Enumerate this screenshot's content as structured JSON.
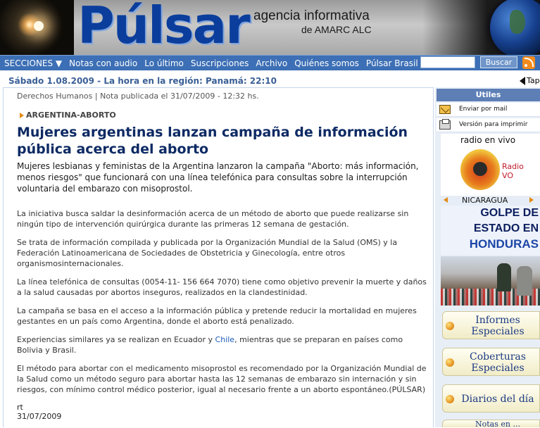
{
  "header": {
    "brand": "Púlsar",
    "tagline_line1": "agencia informativa",
    "tagline_line2": "de AMARC ALC"
  },
  "nav": {
    "items": [
      "SECCIONES ▼",
      "Notas con audio",
      "Lo último",
      "Suscripciones",
      "Archivo",
      "Quiénes somos",
      "Púlsar Brasil"
    ],
    "search_button": "Buscar",
    "search_placeholder": ""
  },
  "datebar": {
    "text": "Sábado 1.08.2009 -  La hora en la región:  Panamá: 22:10",
    "tap_label": "Tap"
  },
  "article": {
    "meta": "Derechos Humanos | Nota publicada el 31/07/2009 - 12:32 hs.",
    "kicker": "ARGENTINA-ABORTO",
    "headline": "Mujeres argentinas lanzan campaña de información pública acerca del aborto",
    "lead": "Mujeres lesbianas y feministas de la Argentina lanzaron la campaña \"Aborto: más información, menos riesgos\" que funcionará con una línea telefónica para consultas sobre la interrupción voluntaria del embarazo con misoprostol.",
    "paragraphs": [
      "La iniciativa busca saldar la desinformación acerca de un método de aborto que puede realizarse sin ningún tipo de intervención quirúrgica durante las primeras 12 semana de gestación.",
      "Se trata de información compilada y publicada por la Organización Mundial de la Salud (OMS) y la Federación Latinoamericana de Sociedades de Obstetricia y Ginecología, entre otros organismosinternacionales.",
      "La línea telefónica de consultas (0054-11- 156 664 7070) tiene como objetivo prevenir la muerte y daños a la salud causadas por abortos inseguros, realizados en la clandestinidad.",
      "La campaña se basa en el acceso a la información pública y pretende reducir la mortalidad en mujeres gestantes en un país como Argentina, donde el aborto está penalizado."
    ],
    "para5_before": "Experiencias similares ya se realizan en Ecuador y ",
    "para5_link": "Chile",
    "para5_after": ", mientras que se preparan en países como Bolivia y Brasil.",
    "para6": "El método para abortar con el medicamento misoprostol es recomendado por la Organización Mundial de la Salud como un método seguro para abortar hasta las 12 semanas de embarazo sin internación y sin riesgos, con mínimo control médico posterior, igual al necesario frente a un aborto espontáneo.(PÚLSAR)",
    "author": "rt",
    "date": "31/07/2009"
  },
  "sidebar": {
    "utiles_title": "Utiles",
    "email_label": "Enviar por mail",
    "print_label": "Versión para imprimir",
    "radio_title": "radio en vivo",
    "radio_name_line1": "Radio",
    "radio_name_line2": "VO",
    "carousel_label": "NICARAGUA",
    "golpe_line1": "GOLPE DE",
    "golpe_line2": "ESTADO EN",
    "golpe_line3": "HONDURAS",
    "buttons": [
      {
        "line1": "Informes",
        "line2": "Especiales"
      },
      {
        "line1": "Coberturas",
        "line2": "Especiales"
      },
      {
        "line1": "Diarios del día",
        "line2": ""
      },
      {
        "line1": "Notas en ...",
        "line2": ""
      }
    ]
  }
}
